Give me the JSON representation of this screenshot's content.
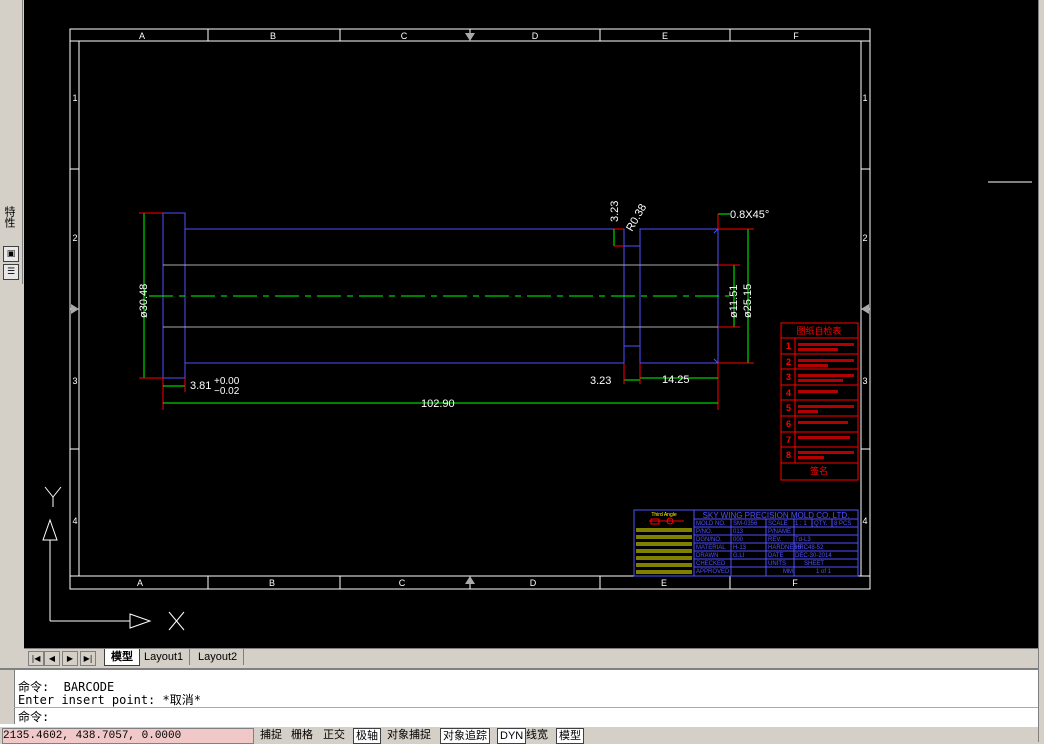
{
  "palette": {
    "label": "特性"
  },
  "drawing": {
    "column_labels": [
      "A",
      "B",
      "C",
      "D",
      "E",
      "F"
    ],
    "row_labels": [
      "1",
      "2",
      "3",
      "4"
    ],
    "dimensions": {
      "dia_large": "ø30.48",
      "dia_mid": "ø25.15",
      "dia_small": "ø11.51",
      "flange_len": "3.81",
      "tol_plus": "+0.00",
      "tol_minus": "−0.02",
      "total_len": "102.90",
      "groove_top": "3.23",
      "groove_bottom": "3.23",
      "end_len": "14.25",
      "radius": "R0.38",
      "chamfer": "0.8X45°"
    },
    "checklist": {
      "title": "图纸自检表",
      "items": [
        "1",
        "2",
        "3",
        "4",
        "5",
        "6",
        "7",
        "8"
      ],
      "footer": "签名"
    },
    "title_block": {
      "company": "SKY WING PRECISION MOLD CO. LTD.",
      "projection_label": "Third Angle",
      "labels": [
        "MOLD NO.",
        "P/NO.",
        "DGN/NO.",
        "MATERIAL",
        "DRAWN",
        "CHECKED",
        "APPROVED"
      ],
      "values": [
        "SM-0356",
        "013",
        "000",
        "H-13",
        "G.LI",
        "",
        ""
      ],
      "mid_labels": [
        "SCALE",
        "P/NAME",
        "REV.",
        "HARDNESS",
        "DATE",
        "UNITS"
      ],
      "mid_values": [
        "1 : 1",
        "",
        "Td-L3",
        "HRC48-52",
        "DEC-30-2014",
        "MM"
      ],
      "qty_label": "QTY.",
      "qty_value": "8 PCS",
      "sheet_label": "SHEET",
      "sheet_value": "1 of 1"
    },
    "ucs": {
      "x": "X",
      "y": "Y"
    }
  },
  "tabs": {
    "model": "模型",
    "layout1": "Layout1",
    "layout2": "Layout2"
  },
  "command": {
    "line1": "命令:  BARCODE",
    "line2": "Enter insert point: *取消*",
    "line3": "命令:"
  },
  "status": {
    "coords": "2135.4602,  438.7057,  0.0000",
    "buttons": [
      "捕捉",
      "栅格",
      "正交",
      "极轴",
      "对象捕捉",
      "对象追踪",
      "DYN",
      "线宽",
      "模型"
    ]
  },
  "colors": {
    "green": "#00ff00",
    "red": "#ff0000",
    "blue": "#5050ff",
    "yellow": "#ffff00",
    "white": "#ffffff"
  }
}
